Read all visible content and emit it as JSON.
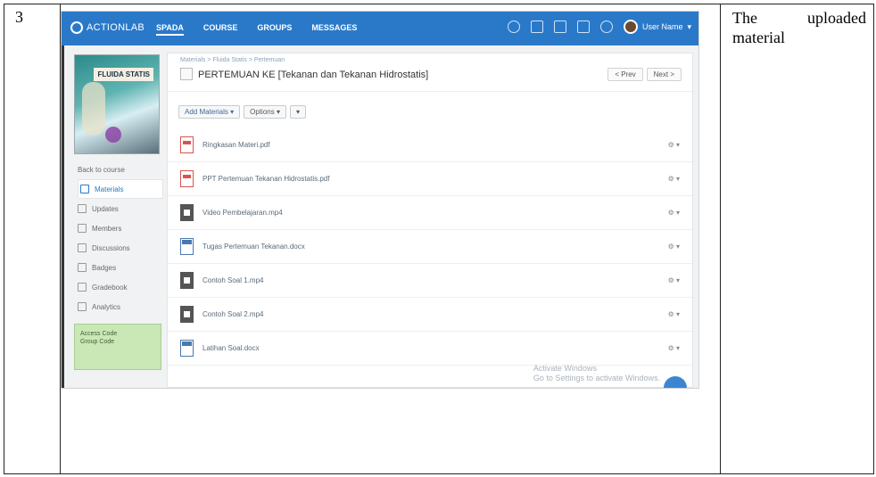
{
  "row": {
    "number": "3",
    "description": "The uploaded material"
  },
  "app": {
    "logo": "ACTIONLAB",
    "nav": [
      "SPADA",
      "COURSE",
      "GROUPS",
      "MESSAGES"
    ],
    "user": "User Name"
  },
  "book": {
    "cover_title": "FLUIDA STATIS"
  },
  "sidebar": {
    "items": [
      {
        "label": "Back to course",
        "active": false
      },
      {
        "label": "Materials",
        "active": true
      },
      {
        "label": "Updates",
        "active": false
      },
      {
        "label": "Members",
        "active": false
      },
      {
        "label": "Discussions",
        "active": false
      },
      {
        "label": "Badges",
        "active": false
      },
      {
        "label": "Gradebook",
        "active": false
      },
      {
        "label": "Analytics",
        "active": false
      }
    ],
    "course_code": {
      "label": "Access Code",
      "value": "Group Code"
    }
  },
  "main": {
    "breadcrumb": "Materials > Fluida Statis > Pertemuan",
    "title": "PERTEMUAN KE [Tekanan dan Tekanan Hidrostatis]",
    "prev_label": "< Prev",
    "next_label": "Next >",
    "toolbar": {
      "add_label": "Add Materials ▾",
      "options_label": "Options ▾",
      "more_label": "▾"
    },
    "files": [
      {
        "type": "pdf",
        "name": "Ringkasan Materi.pdf"
      },
      {
        "type": "pdf",
        "name": "PPT Pertemuan Tekanan Hidrostatis.pdf"
      },
      {
        "type": "video",
        "name": "Video Pembelajaran.mp4"
      },
      {
        "type": "doc",
        "name": "Tugas Pertemuan Tekanan.docx"
      },
      {
        "type": "video",
        "name": "Contoh Soal 1.mp4"
      },
      {
        "type": "video",
        "name": "Contoh Soal 2.mp4"
      },
      {
        "type": "doc",
        "name": "Latihan Soal.docx"
      }
    ],
    "file_menu": "⚙ ▾",
    "watermark": [
      "Activate Windows",
      "Go to Settings to activate Windows."
    ]
  },
  "colors": {
    "topbar": "#2a79c9",
    "code_box": "#c9e8b5",
    "pdf": "#d9534f"
  }
}
